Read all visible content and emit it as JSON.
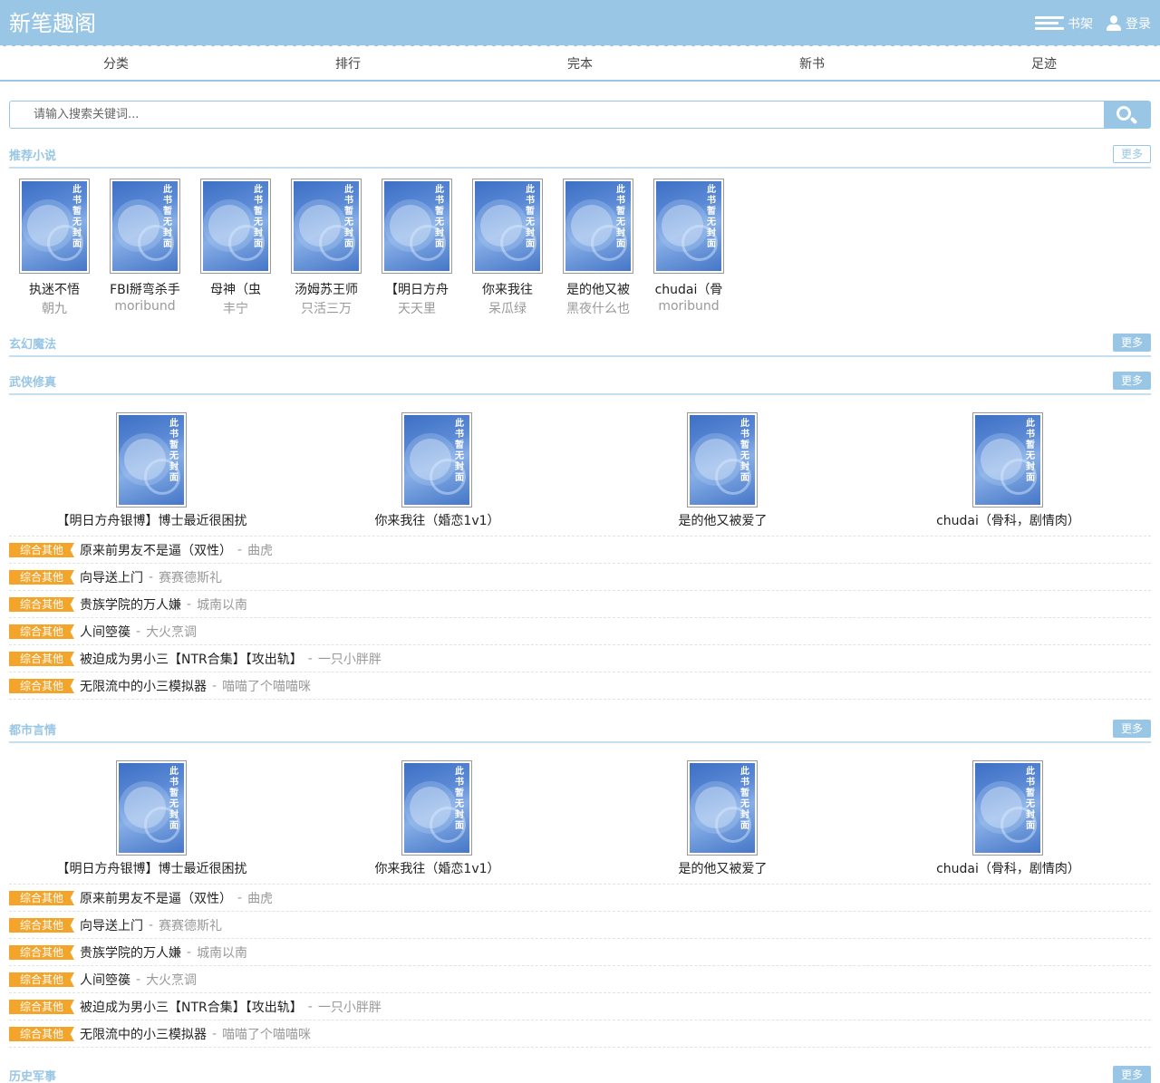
{
  "header": {
    "site_title": "新笔趣阁",
    "bookshelf_label": "书架",
    "login_label": "登录"
  },
  "nav": [
    "分类",
    "排行",
    "完本",
    "新书",
    "足迹"
  ],
  "search": {
    "placeholder": "请输入搜索关键词..."
  },
  "cover_text": "此书暂无封面",
  "recommended": {
    "title": "推荐小说",
    "more": "更多",
    "books": [
      {
        "title": "执迷不悟",
        "author": "朝九"
      },
      {
        "title": "FBI掰弯杀手",
        "author": "moribund"
      },
      {
        "title": "母神（虫",
        "author": "丰宁"
      },
      {
        "title": "汤姆苏王师",
        "author": "只活三万"
      },
      {
        "title": "【明日方舟",
        "author": "天天里"
      },
      {
        "title": "你来我往",
        "author": "呆瓜绿"
      },
      {
        "title": "是的他又被",
        "author": "黑夜什么也"
      },
      {
        "title": "chudai（骨",
        "author": "moribund"
      }
    ]
  },
  "sections": [
    {
      "title": "玄幻魔法",
      "more": "更多",
      "featured": [],
      "list": []
    },
    {
      "title": "武侠修真",
      "more": "更多",
      "featured": [
        "【明日方舟银博】博士最近很困扰",
        "你来我往（婚恋1v1）",
        "是的他又被爱了",
        "chudai（骨科，剧情肉）"
      ],
      "list": [
        {
          "tag": "综合其他",
          "title": "原来前男友不是逼（双性）",
          "author": "曲虎"
        },
        {
          "tag": "综合其他",
          "title": "向导送上门",
          "author": "赛赛德斯礼"
        },
        {
          "tag": "综合其他",
          "title": "贵族学院的万人嫌",
          "author": "城南以南"
        },
        {
          "tag": "综合其他",
          "title": "人间箜篌",
          "author": "大火烹调"
        },
        {
          "tag": "综合其他",
          "title": "被迫成为男小三【NTR合集】【攻出轨】",
          "author": "一只小胖胖"
        },
        {
          "tag": "综合其他",
          "title": "无限流中的小三模拟器",
          "author": "喵喵了个喵喵咪"
        }
      ]
    },
    {
      "title": "都市言情",
      "more": "更多",
      "featured": [
        "【明日方舟银博】博士最近很困扰",
        "你来我往（婚恋1v1）",
        "是的他又被爱了",
        "chudai（骨科，剧情肉）"
      ],
      "list": [
        {
          "tag": "综合其他",
          "title": "原来前男友不是逼（双性）",
          "author": "曲虎"
        },
        {
          "tag": "综合其他",
          "title": "向导送上门",
          "author": "赛赛德斯礼"
        },
        {
          "tag": "综合其他",
          "title": "贵族学院的万人嫌",
          "author": "城南以南"
        },
        {
          "tag": "综合其他",
          "title": "人间箜篌",
          "author": "大火烹调"
        },
        {
          "tag": "综合其他",
          "title": "被迫成为男小三【NTR合集】【攻出轨】",
          "author": "一只小胖胖"
        },
        {
          "tag": "综合其他",
          "title": "无限流中的小三模拟器",
          "author": "喵喵了个喵喵咪"
        }
      ]
    },
    {
      "title": "历史军事",
      "more": "更多",
      "featured": [],
      "list": []
    }
  ]
}
